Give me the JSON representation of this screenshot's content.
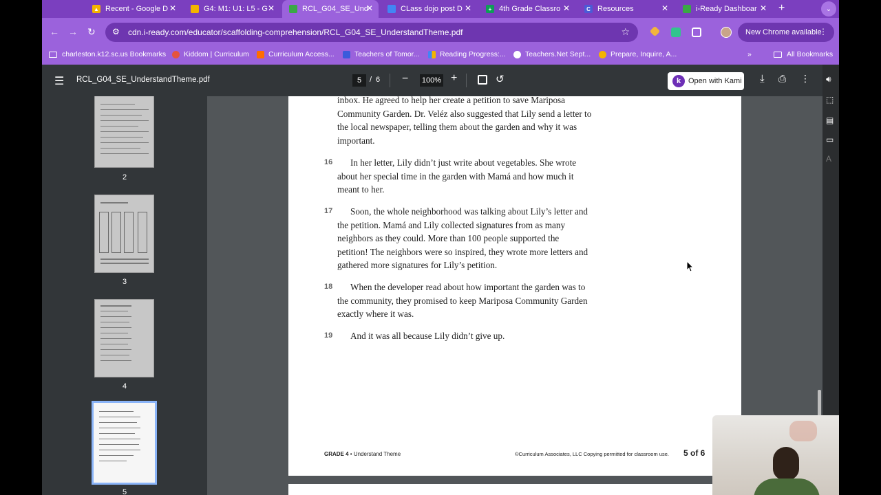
{
  "tabs": [
    {
      "title": "Recent - Google D",
      "color": "#f4b400",
      "active": false
    },
    {
      "title": "G4: M1: U1: L5 - G",
      "color": "#f4b400",
      "active": false
    },
    {
      "title": "RCL_G04_SE_Und",
      "color": "#3aa845",
      "active": true
    },
    {
      "title": "CLass dojo post D",
      "color": "#4285f4",
      "active": false
    },
    {
      "title": "4th Grade Classro",
      "color": "#0f9d58",
      "active": false
    },
    {
      "title": "Resources",
      "color": "#4b5bd6",
      "active": false
    },
    {
      "title": "i-Ready Dashboar",
      "color": "#3aa845",
      "active": false
    }
  ],
  "address": {
    "url": "cdn.i-ready.com/educator/scaffolding-comprehension/RCL_G04_SE_UnderstandTheme.pdf",
    "new_chrome": "New Chrome available"
  },
  "bookmarks": [
    {
      "label": "charleston.k12.sc.us Bookmarks",
      "color": "#ffffff"
    },
    {
      "label": "Kiddom | Curriculum",
      "color": "#e5533d"
    },
    {
      "label": "Curriculum Access...",
      "color": "#ff6d00"
    },
    {
      "label": "Teachers of Tomor...",
      "color": "#3b5bdb"
    },
    {
      "label": "Reading Progress:...",
      "color": "#4285f4"
    },
    {
      "label": "Teachers.Net Sept...",
      "color": "#ffffff"
    },
    {
      "label": "Prepare, Inquire, A...",
      "color": "#f4b400"
    }
  ],
  "all_bookmarks": "All Bookmarks",
  "pdf": {
    "filename": "RCL_G04_SE_UnderstandTheme.pdf",
    "current_page": "5",
    "page_separator": "/",
    "total_pages": "6",
    "zoom": "100%",
    "kami_label": "Open with Kami"
  },
  "thumbnails": [
    {
      "number": "2"
    },
    {
      "number": "3"
    },
    {
      "number": "4"
    },
    {
      "number": "5"
    }
  ],
  "document": {
    "paragraphs": [
      {
        "num": "",
        "text": "inbox. He agreed to help her create a petition to save Mariposa Community Garden. Dr. Veléz also suggested that Lily send a letter to the local newspaper, telling them about the garden and why it was important."
      },
      {
        "num": "16",
        "text": "In her letter, Lily didn’t just write about vegetables. She wrote about her special time in the garden with Mamá and how much it meant to her."
      },
      {
        "num": "17",
        "text": "Soon, the whole neighborhood was talking about Lily’s letter and the petition. Mamá and Lily collected signatures from as many neighbors as they could. More than 100 people supported the petition! The neighbors were so inspired, they wrote more letters and gathered more signatures for Lily’s petition."
      },
      {
        "num": "18",
        "text": "When the developer read about how important the garden was to the community, they promised to keep Mariposa Community Garden exactly where it was."
      },
      {
        "num": "19",
        "text": "And it was all because Lily didn’t give up."
      }
    ],
    "footer_grade": "GRADE 4",
    "footer_topic": "Understand Theme",
    "footer_copyright": "©Curriculum Associates, LLC    Copying permitted for classroom use.",
    "footer_page": "5 of 6"
  }
}
